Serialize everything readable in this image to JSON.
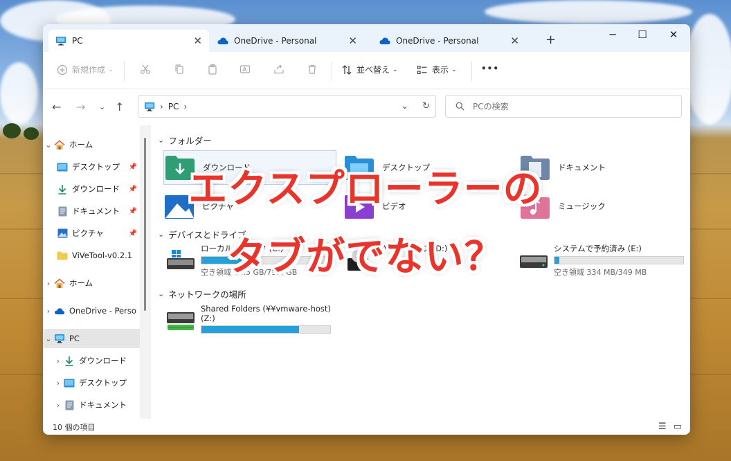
{
  "tabs": [
    {
      "label": "PC",
      "active": true,
      "icon": "pc-icon"
    },
    {
      "label": "OneDrive - Personal",
      "active": false,
      "icon": "onedrive-cloud-icon"
    },
    {
      "label": "OneDrive - Personal",
      "active": false,
      "icon": "onedrive-cloud-icon"
    }
  ],
  "window_controls": {
    "new_tab": "+",
    "minimize": "─",
    "maximize": "☐",
    "close": "✕"
  },
  "toolbar": {
    "new_label": "新規作成",
    "sort_label": "並べ替え",
    "view_label": "表示",
    "more_label": "•••"
  },
  "address": {
    "root": "PC",
    "chevron_after": "›"
  },
  "search": {
    "placeholder": "PCの検索"
  },
  "sidebar": {
    "items": [
      {
        "label": "ホーム",
        "icon": "home-icon"
      },
      {
        "label": "デスクトップ",
        "icon": "desktop-icon"
      },
      {
        "label": "ダウンロード",
        "icon": "download-icon"
      },
      {
        "label": "ドキュメント",
        "icon": "document-icon"
      },
      {
        "label": "ピクチャ",
        "icon": "pictures-icon"
      },
      {
        "label": "ViVeTool-v0.2.1",
        "icon": "folder-icon"
      },
      {
        "label": "ホーム",
        "icon": "home-icon"
      },
      {
        "label": "OneDrive - Perso",
        "icon": "onedrive-cloud-icon"
      },
      {
        "label": "PC",
        "icon": "pc-icon"
      },
      {
        "label": "ダウンロード",
        "icon": "download-icon"
      },
      {
        "label": "デスクトップ",
        "icon": "desktop-icon"
      },
      {
        "label": "ドキュメント",
        "icon": "document-icon"
      }
    ]
  },
  "content": {
    "folders_header": "フォルダー",
    "folders": [
      {
        "label": "ダウンロード",
        "icon": "download-folder-icon"
      },
      {
        "label": "デスクトップ",
        "icon": "desktop-folder-icon"
      },
      {
        "label": "ドキュメント",
        "icon": "documents-folder-icon"
      },
      {
        "label": "ピクチャ",
        "icon": "pictures-folder-icon"
      },
      {
        "label": "ビデオ",
        "icon": "videos-folder-icon"
      },
      {
        "label": "ミュージック",
        "icon": "music-folder-icon"
      }
    ],
    "drives_header": "デバイスとドライブ",
    "drives": [
      {
        "name": "ローカル ディスク (C:)",
        "free": "空き領域 53.5 GB/79.4 GB",
        "used_fraction": 0.33,
        "icon": "windows-drive-icon"
      },
      {
        "name": "DVD ドライブ (D:)",
        "free": "",
        "used_fraction": 0,
        "icon": "dvd-drive-icon"
      },
      {
        "name": "システムで予約済み (E:)",
        "free": "空き領域 334 MB/349 MB",
        "used_fraction": 0.04,
        "icon": "drive-icon"
      }
    ],
    "network_header": "ネットワークの場所",
    "network": [
      {
        "name": "Shared Folders (¥¥vmware-host)",
        "name2": "(Z:)",
        "used_fraction": 0.76,
        "icon": "network-drive-icon"
      }
    ]
  },
  "status": {
    "item_count": "10 個の項目"
  },
  "overlay": {
    "line1": "エクスプローラーの",
    "line2": "タブがでない？",
    "color": "#e8342a"
  }
}
